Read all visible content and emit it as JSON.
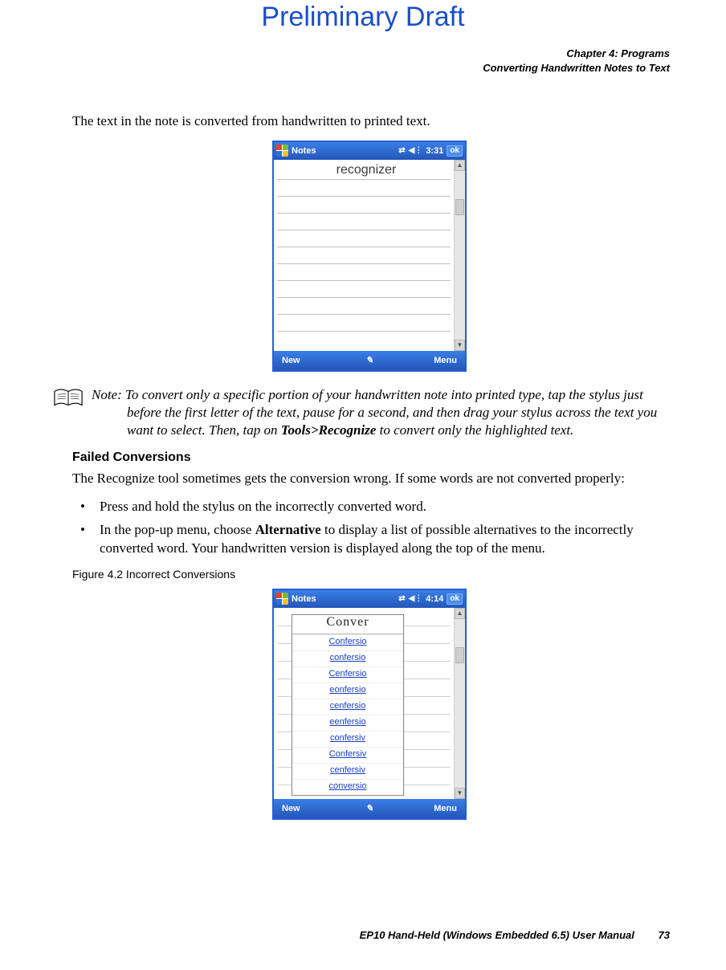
{
  "watermark": "Preliminary Draft",
  "header": {
    "chapter": "Chapter 4: Programs",
    "section": "Converting Handwritten Notes to Text"
  },
  "intro_para": "The text in the note is converted from handwritten to printed text.",
  "fig1": {
    "title": "Notes",
    "clock": "3:31",
    "ok": "ok",
    "content_word": "recognizer",
    "soft_left": "New",
    "soft_right": "Menu"
  },
  "note": {
    "label": "Note:",
    "body_pre": "To convert only a specific portion of your handwritten note into printed type, tap the stylus just before the first letter of the text, pause for a second, and then drag your stylus across the text you want to select. Then, tap on ",
    "toolpath": "Tools>Recognize",
    "body_post": " to convert only the highlighted text."
  },
  "failed_heading": "Failed Conversions",
  "failed_para": "The Recognize tool sometimes gets the conversion wrong. If some words are not converted properly:",
  "bullets": [
    {
      "pre": "Press and hold the stylus on the incorrectly converted word.",
      "bold": "",
      "post": ""
    },
    {
      "pre": "In the pop-up menu, choose ",
      "bold": "Alternative",
      "post": " to display a list of possible alternatives to the incorrectly converted word. Your handwritten version is displayed along the top of the menu."
    }
  ],
  "fig2_caption": "Figure 4.2  Incorrect Conversions",
  "fig2": {
    "title": "Notes",
    "clock": "4:14",
    "ok": "ok",
    "handwritten": "Conver",
    "alternatives": [
      "Confersio",
      "confersio",
      "Cenfersio",
      "eonfersio",
      "cenfersio",
      "eenfersio",
      "confersiv",
      "Confersiv",
      "cenfersiv",
      "conversio"
    ],
    "soft_left": "New",
    "soft_right": "Menu"
  },
  "footer": {
    "manual": "EP10 Hand-Held (Windows Embedded 6.5) User Manual",
    "page": "73"
  }
}
